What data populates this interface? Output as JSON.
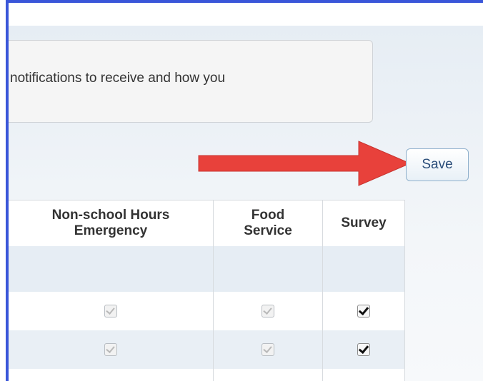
{
  "notice": {
    "text": "notifications to receive and how you"
  },
  "toolbar": {
    "save_label": "Save"
  },
  "annotation": {
    "arrow_color": "#e8413b"
  },
  "table": {
    "columns": [
      {
        "line1": "Non-school Hours",
        "line2": "Emergency"
      },
      {
        "line1": "Food",
        "line2": "Service"
      },
      {
        "line1": "Survey",
        "line2": ""
      }
    ],
    "rows": [
      {
        "non_school_hours_emergency": "checked-disabled",
        "food_service": "checked-disabled",
        "survey": "checked"
      },
      {
        "non_school_hours_emergency": "checked-disabled",
        "food_service": "checked-disabled",
        "survey": "checked"
      }
    ]
  },
  "colors": {
    "window_border": "#3a56d9",
    "band": "#e6edf4"
  }
}
